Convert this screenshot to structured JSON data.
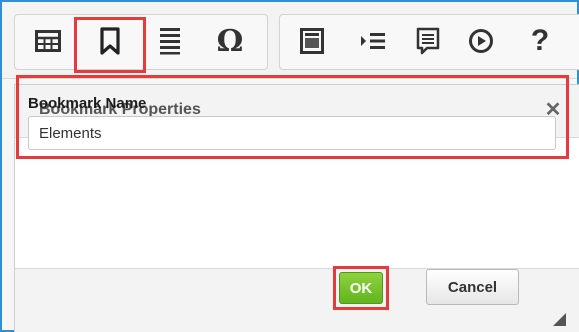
{
  "toolbar": {
    "icons": [
      {
        "name": "table-icon"
      },
      {
        "name": "bookmark-icon"
      },
      {
        "name": "horizontal-lines-icon"
      },
      {
        "name": "special-character-icon",
        "glyph": "Ω"
      },
      {
        "name": "iframe-icon"
      },
      {
        "name": "indent-list-icon"
      },
      {
        "name": "comment-icon"
      },
      {
        "name": "play-icon"
      },
      {
        "name": "help-icon",
        "glyph": "?"
      }
    ]
  },
  "dialog": {
    "title": "Bookmark Properties",
    "close_glyph": "✕",
    "field": {
      "label": "Bookmark Name",
      "value": "Elements"
    },
    "ok_label": "OK",
    "cancel_label": "Cancel"
  },
  "colors": {
    "highlight": "#e53b3b",
    "ok_green": "#6cbf24",
    "frame_blue": "#2f8fd1"
  }
}
